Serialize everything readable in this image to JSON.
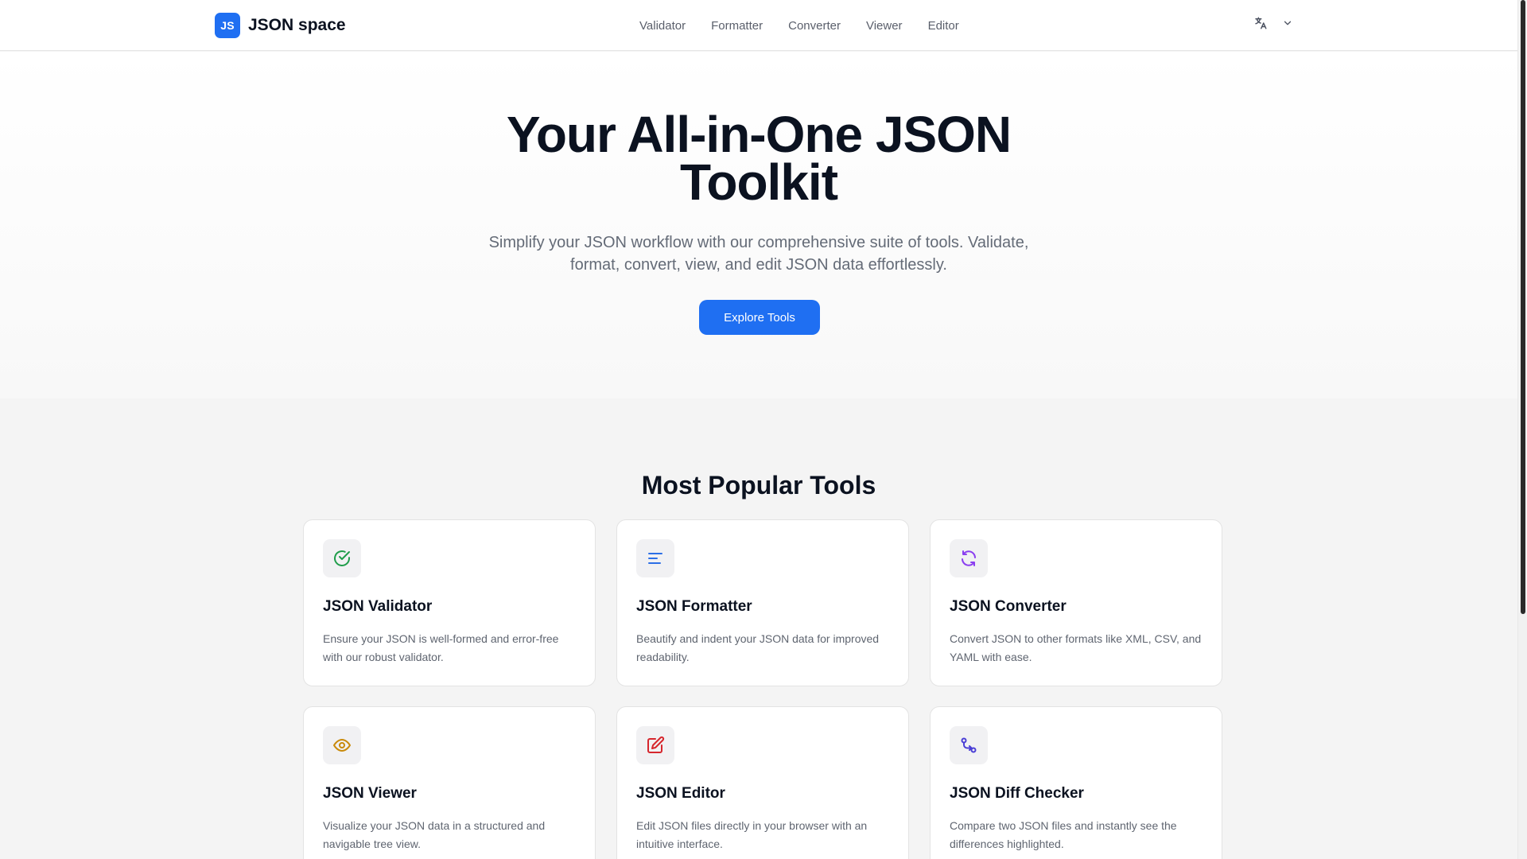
{
  "header": {
    "logo_badge": "JS",
    "logo_text": "JSON space",
    "nav": [
      {
        "label": "Validator"
      },
      {
        "label": "Formatter"
      },
      {
        "label": "Converter"
      },
      {
        "label": "Viewer"
      },
      {
        "label": "Editor"
      }
    ],
    "language_icon": "translate-icon",
    "language_dropdown_icon": "chevron-down-icon"
  },
  "hero": {
    "title": "Your All-in-One JSON Toolkit",
    "subtitle": "Simplify your JSON workflow with our comprehensive suite of tools. Validate, format, convert, view, and edit JSON data effortlessly.",
    "cta": "Explore Tools"
  },
  "tools": {
    "title": "Most Popular Tools",
    "cards": [
      {
        "title": "JSON Validator",
        "desc": "Ensure your JSON is well-formed and error-free with our robust validator.",
        "icon": "check-circle-icon",
        "icon_color": "#1f9d4a"
      },
      {
        "title": "JSON Formatter",
        "desc": "Beautify and indent your JSON data for improved readability.",
        "icon": "align-left-icon",
        "icon_color": "#2c6fe6"
      },
      {
        "title": "JSON Converter",
        "desc": "Convert JSON to other formats like XML, CSV, and YAML with ease.",
        "icon": "refresh-icon",
        "icon_color": "#8b3ff0"
      },
      {
        "title": "JSON Viewer",
        "desc": "Visualize your JSON data in a structured and navigable tree view.",
        "icon": "eye-icon",
        "icon_color": "#c98a0b"
      },
      {
        "title": "JSON Editor",
        "desc": "Edit JSON files directly in your browser with an intuitive interface.",
        "icon": "edit-icon",
        "icon_color": "#d6262d"
      },
      {
        "title": "JSON Diff Checker",
        "desc": "Compare two JSON files and instantly see the differences highlighted.",
        "icon": "git-compare-icon",
        "icon_color": "#4b3fd6"
      }
    ]
  },
  "colors": {
    "accent": "#1f6ff2",
    "text_primary": "#0b1220",
    "text_secondary": "#646b77"
  }
}
